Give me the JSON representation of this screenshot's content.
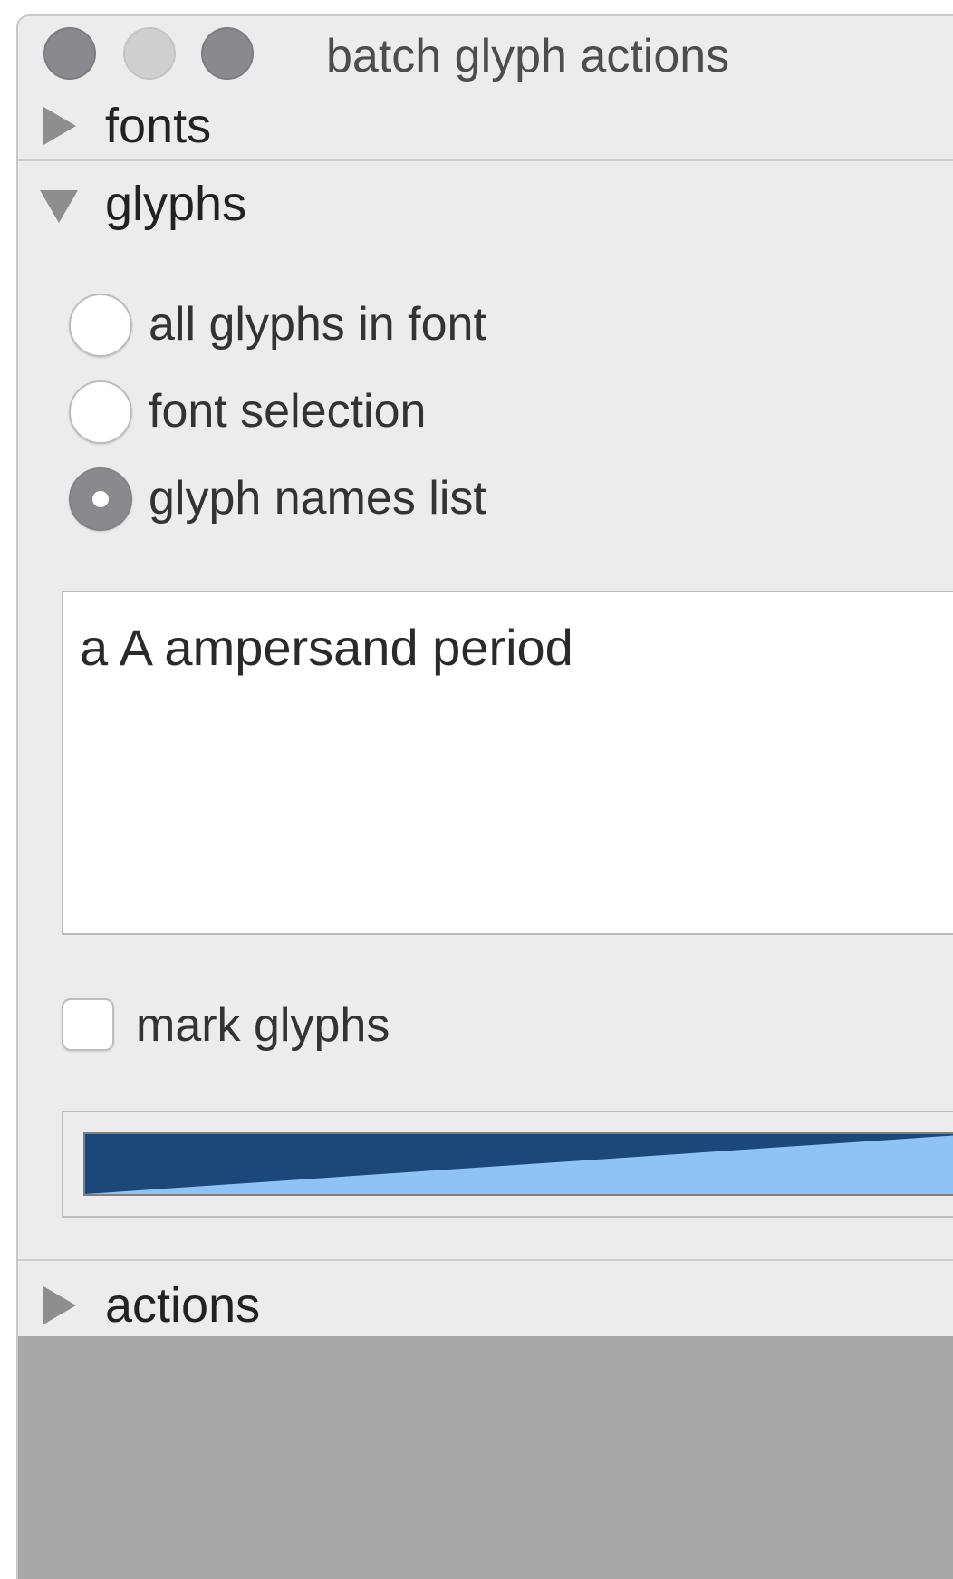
{
  "window": {
    "title": "batch glyph actions"
  },
  "sections": {
    "fonts": {
      "label": "fonts",
      "expanded": false
    },
    "glyphs": {
      "label": "glyphs",
      "expanded": true
    },
    "actions": {
      "label": "actions",
      "expanded": false
    }
  },
  "glyphs": {
    "options": [
      {
        "label": "all glyphs in font",
        "selected": false
      },
      {
        "label": "font selection",
        "selected": false
      },
      {
        "label": "glyph names list",
        "selected": true
      }
    ],
    "names_list_value": "a A ampersand period",
    "mark_glyphs": {
      "label": "mark glyphs",
      "checked": false
    },
    "mark_color": {
      "primary": "#1b4878",
      "secondary": "#90c3f5"
    }
  },
  "colors": {
    "window_bg": "#ececec",
    "traffic_light_inactive": "#8a8a8e"
  }
}
